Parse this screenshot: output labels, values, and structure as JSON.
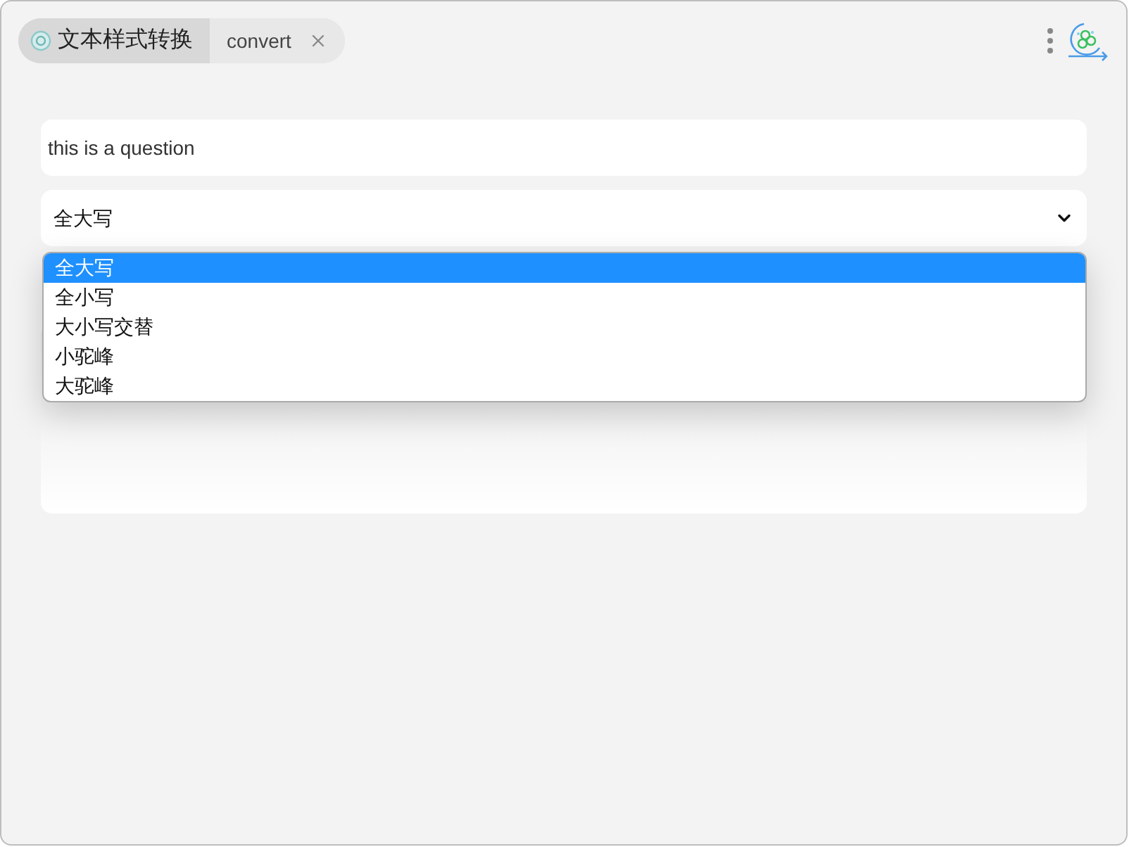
{
  "tabs": [
    {
      "label": "文本样式转换",
      "kind": "plugin",
      "selected": true
    },
    {
      "label": "convert",
      "kind": "query",
      "selected": false
    }
  ],
  "input": {
    "value": "this is a question"
  },
  "select": {
    "value": "全大写",
    "expanded": true
  },
  "options": [
    {
      "label": "全大写",
      "selected": true
    },
    {
      "label": "全小写",
      "selected": false
    },
    {
      "label": "大小写交替",
      "selected": false
    },
    {
      "label": "小驼峰",
      "selected": false
    },
    {
      "label": "大驼峰",
      "selected": false
    }
  ]
}
